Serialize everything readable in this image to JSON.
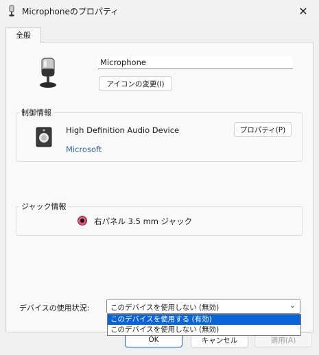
{
  "window": {
    "title": "Microphoneのプロパティ",
    "close_icon": "close-icon"
  },
  "tabs": [
    {
      "label": "全般",
      "active": true
    }
  ],
  "general": {
    "device_name_value": "Microphone",
    "change_icon_label": "アイコンの変更(I)"
  },
  "controller": {
    "legend": "制御情報",
    "device_label": "High Definition Audio Device",
    "vendor_link": "Microsoft",
    "properties_label": "プロパティ(P)"
  },
  "jack": {
    "legend": "ジャック情報",
    "jack_color": "#d15f7d",
    "jack_label": "右パネル 3.5 mm ジャック"
  },
  "usage": {
    "label": "デバイスの使用状況:",
    "selected_value": "このデバイスを使用しない (無効)",
    "options": [
      {
        "label": "このデバイスを使用する (有効)",
        "highlighted": true
      },
      {
        "label": "このデバイスを使用しない (無効)",
        "highlighted": false
      }
    ]
  },
  "footer": {
    "ok_label": "OK",
    "cancel_label": "キャンセル",
    "apply_label": "適用(A)",
    "apply_enabled": false
  },
  "colors": {
    "accent": "#0a64d7",
    "link": "#3a67a8",
    "background": "#f0f0f0"
  }
}
